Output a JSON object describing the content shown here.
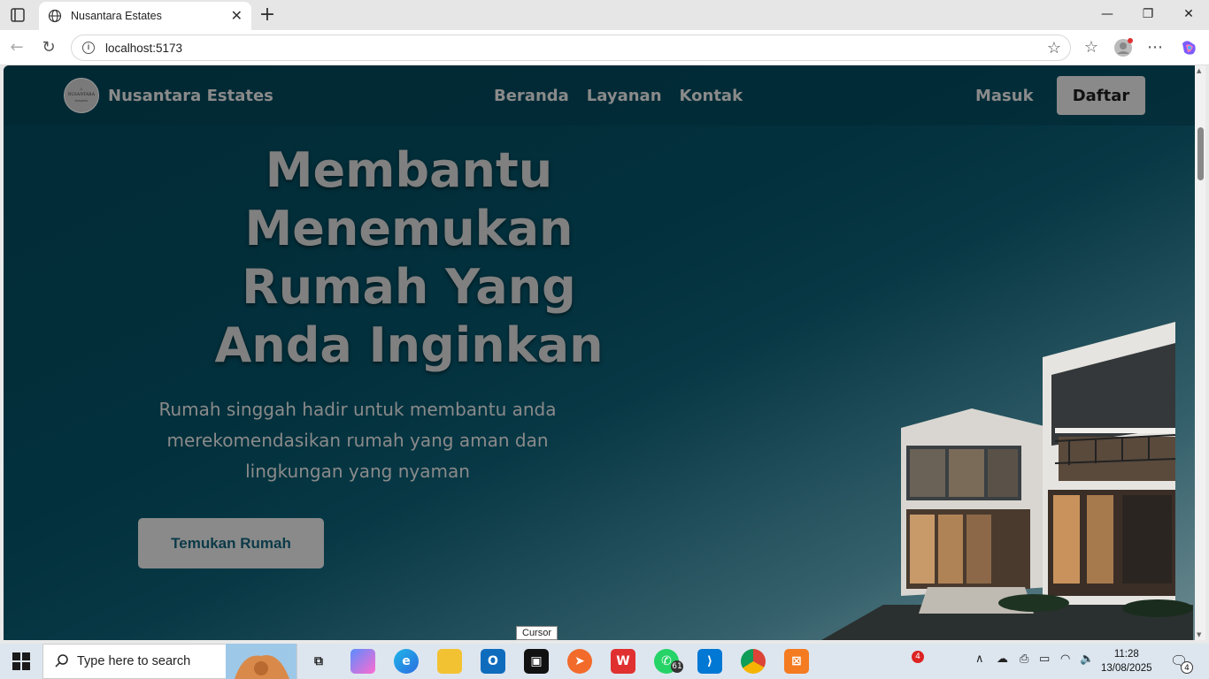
{
  "browser": {
    "tab_title": "Nusantara Estates",
    "url": "localhost:5173"
  },
  "site": {
    "brand": "Nusantara Estates",
    "logo_text_top": "NUSANTARA",
    "logo_text_bottom": "ESTATES",
    "nav": [
      "Beranda",
      "Layanan",
      "Kontak"
    ],
    "login": "Masuk",
    "register": "Daftar",
    "hero_title": "Membantu Menemukan Rumah Yang Anda Inginkan",
    "hero_subtitle": "Rumah singgah hadir untuk membantu anda merekomendasikan rumah yang aman dan lingkungan yang nyaman",
    "cta": "Temukan Rumah"
  },
  "taskbar": {
    "search_placeholder": "Type here to search",
    "tooltip": "Cursor",
    "whatsapp_badge": "61",
    "tray_badge": "4",
    "notification_count": "4",
    "time": "11:28",
    "date": "13/08/2025"
  },
  "colors": {
    "hero_dark": "#022b36",
    "muted_text": "#8a8a8a"
  }
}
